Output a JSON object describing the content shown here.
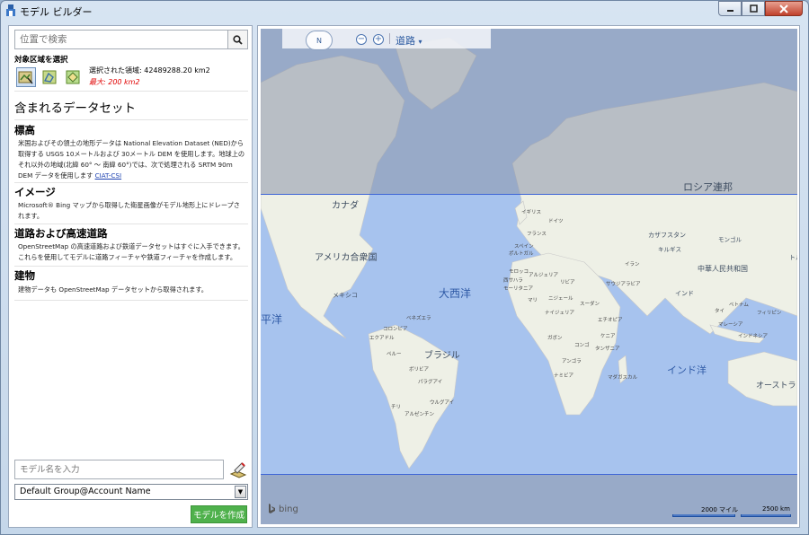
{
  "window": {
    "title": "モデル ビルダー"
  },
  "left": {
    "search_placeholder": "位置で検索",
    "area_label": "対象区域を選択",
    "selected_area": "選択された領域: 42489288.20 km2",
    "max_area": "最大: 200 km2",
    "datasets_heading": "含まれるデータセット",
    "sections": [
      {
        "title": "標高",
        "desc": "米国およびその領土の地形データは National Elevation Dataset (NED)から取得する USGS 10メートルおよび 30メートル DEM を使用します。地球上のそれ以外の地域(北緯 60° ～ 南緯 60°)では、次で処理される SRTM 90m DEM データを使用します",
        "link": "CIAT-CSI"
      },
      {
        "title": "イメージ",
        "desc": "Microsoft® Bing マップから取得した衛星画像がモデル地形上にドレープされます。"
      },
      {
        "title": "道路および高速道路",
        "desc": "OpenStreetMap の高速道路および鉄道データセットはすぐに入手できます。これらを使用してモデルに道路フィーチャや鉄道フィーチャを作成します。"
      },
      {
        "title": "建物",
        "desc": "建物データも OpenStreetMap データセットから取得されます。"
      }
    ],
    "model_name_placeholder": "モデル名を入力",
    "group_value": "Default Group@Account Name",
    "create_button": "モデルを作成"
  },
  "map": {
    "compass": "N",
    "zoom_out": "−",
    "zoom_in": "+",
    "style_label": "道路",
    "style_arrow": "▾",
    "bing": "bing",
    "scale_miles": "2000 マイル",
    "scale_km": "2500 km",
    "labels": {
      "russia": "ロシア連邦",
      "canada": "カナダ",
      "usa": "アメリカ合衆国",
      "mexico": "メキシコ",
      "brazil": "ブラジル",
      "china": "中華人民共和国",
      "kazakhstan": "カザフスタン",
      "mongolia": "モンゴル",
      "kyrgyzstan": "キルギス",
      "india": "インド",
      "atlantic": "大西洋",
      "pacific": "平洋",
      "indian_ocean": "インド洋",
      "australia": "オーストラ",
      "uk": "イギリス",
      "france": "フランス",
      "germany": "ドイツ",
      "spain": "スペイン",
      "portugal": "ポルトガル",
      "algeria": "アルジェリア",
      "libya": "リビア",
      "sudan": "スーダン",
      "mali": "マリ",
      "ethiopia": "エチオピア",
      "kenya": "ケニア",
      "tanzania": "タンザニア",
      "madagascar": "マダガスカル",
      "namibia": "ナミビア",
      "angola": "アンゴラ",
      "congo": "コンゴ",
      "gabon": "ガボン",
      "mauritania": "モーリタニア",
      "morocco": "モロッコ",
      "western_sahara": "西サハラ",
      "nigeria": "ナイジェリア",
      "niger": "ニジェール",
      "peru": "ペルー",
      "bolivia": "ボリビア",
      "paraguay": "パラグアイ",
      "chile": "チリ",
      "argentina": "アルゼンチン",
      "uruguay": "ウルグアイ",
      "colombia": "コロンビア",
      "venezuela": "ベネズエラ",
      "ecuador": "エクアドル",
      "turkey": "トルコ",
      "iran": "イラン",
      "saudi": "サウジアラビア",
      "philippines": "フィリピン",
      "vietnam": "ベトナム",
      "thailand": "タイ",
      "malaysia": "マレーシア",
      "indonesia": "インドネシア"
    }
  }
}
